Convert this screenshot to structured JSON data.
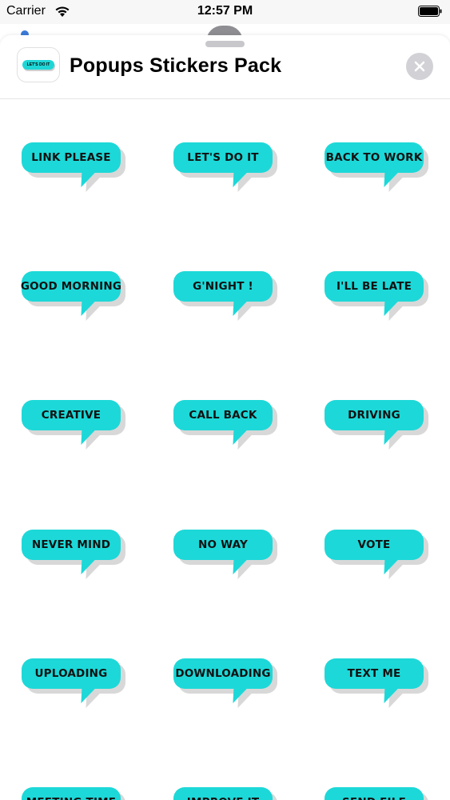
{
  "status_bar": {
    "carrier": "Carrier",
    "time": "12:57 PM"
  },
  "header": {
    "title": "Popups Stickers Pack",
    "icon_text": "LET'S DO IT"
  },
  "colors": {
    "sticker": "#1dd8d8",
    "shadow": "#d8d8d8",
    "close_bg": "#d1d1d6"
  },
  "stickers": [
    "LINK PLEASE",
    "LET'S DO IT",
    "BACK TO WORK",
    "GOOD MORNING",
    "G'NIGHT !",
    "I'LL BE LATE",
    "CREATIVE",
    "CALL BACK",
    "DRIVING",
    "NEVER MIND",
    "NO WAY",
    "VOTE",
    "UPLOADING",
    "DOWNLOADING",
    "TEXT ME",
    "MEETING TIME",
    "IMPROVE IT",
    "SEND FILE"
  ]
}
